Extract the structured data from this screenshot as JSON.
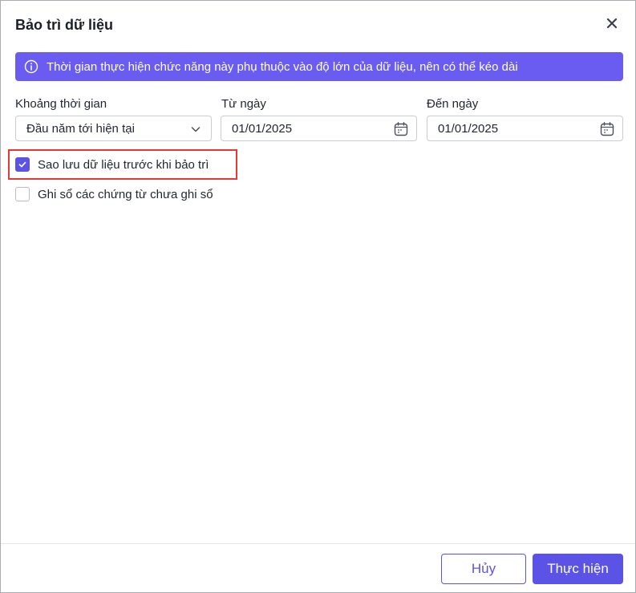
{
  "dialog": {
    "title": "Bảo trì dữ liệu",
    "close_icon": "close-icon"
  },
  "banner": {
    "icon": "info-icon",
    "text": "Thời gian thực hiện chức năng này phụ thuộc vào độ lớn của dữ liệu, nên có thể kéo dài",
    "color": "#6a5cf0"
  },
  "form": {
    "period": {
      "label": "Khoảng thời gian",
      "value": "Đầu năm tới hiện tại",
      "icon": "chevron-down-icon"
    },
    "from_date": {
      "label": "Từ ngày",
      "value": "01/01/2025",
      "icon": "calendar-icon"
    },
    "to_date": {
      "label": "Đến ngày",
      "value": "01/01/2025",
      "icon": "calendar-icon"
    }
  },
  "options": [
    {
      "label": "Sao lưu dữ liệu trước khi bảo trì",
      "checked": true
    },
    {
      "label": "Ghi sổ các chứng từ chưa ghi sổ",
      "checked": false
    }
  ],
  "footer": {
    "cancel_label": "Hủy",
    "submit_label": "Thực hiện"
  },
  "colors": {
    "accent": "#5b52e6",
    "highlight_border": "#e53935"
  }
}
